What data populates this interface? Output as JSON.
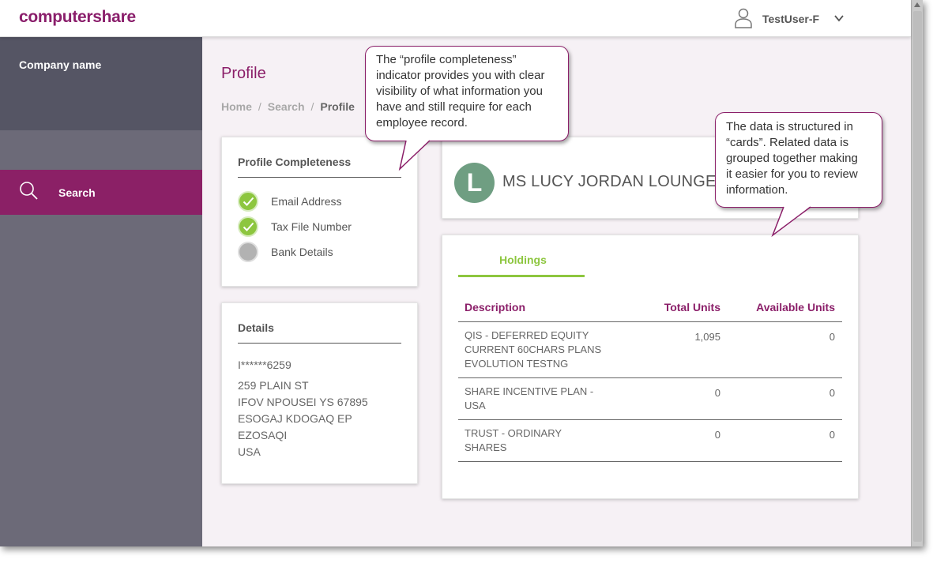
{
  "header": {
    "logo_text": "computershare",
    "user_name": "TestUser-F"
  },
  "sidebar": {
    "company_label": "Company name",
    "nav_search_label": "Search"
  },
  "main": {
    "page_title": "Profile",
    "breadcrumb": {
      "home": "Home",
      "search": "Search",
      "current": "Profile",
      "separator": "/"
    }
  },
  "completeness": {
    "title": "Profile Completeness",
    "items": [
      {
        "label": "Email Address",
        "status": "complete"
      },
      {
        "label": "Tax File Number",
        "status": "complete"
      },
      {
        "label": "Bank Details",
        "status": "incomplete"
      }
    ]
  },
  "details": {
    "title": "Details",
    "lines": [
      "I******6259",
      "259 PLAIN ST",
      "IFOV NPOUSEI YS 67895",
      "ESOGAJ KDOGAQ EP",
      "EZOSAQI",
      "USA"
    ]
  },
  "person": {
    "initial": "L",
    "name": "MS LUCY JORDAN LOUNGE"
  },
  "holdings": {
    "tab_label": "Holdings",
    "columns": [
      "Description",
      "Total Units",
      "Available Units"
    ],
    "rows": [
      {
        "description": [
          "QIS - DEFERRED EQUITY",
          "CURRENT 60CHARS PLANS",
          "EVOLUTION TESTNG"
        ],
        "total": "1,095",
        "available": "0"
      },
      {
        "description": [
          "SHARE INCENTIVE PLAN -",
          "USA"
        ],
        "total": "0",
        "available": "0"
      },
      {
        "description": [
          "TRUST - ORDINARY",
          "SHARES"
        ],
        "total": "0",
        "available": "0"
      }
    ]
  },
  "callouts": {
    "completeness_lines": [
      "The “profile completeness”",
      "indicator provides you with clear",
      "visibility of what information you",
      "have and still require for each",
      "employee record."
    ],
    "cards_lines": [
      "The data is structured in",
      "“cards”.  Related data is",
      "grouped together making",
      "it easier for you to review",
      "information."
    ]
  },
  "colors": {
    "brand": "#8b1f69",
    "accent_green": "#8dc63f",
    "sidebar": "#6c6a78",
    "sidebar_top": "#555564",
    "avatar": "#6f9e82"
  }
}
